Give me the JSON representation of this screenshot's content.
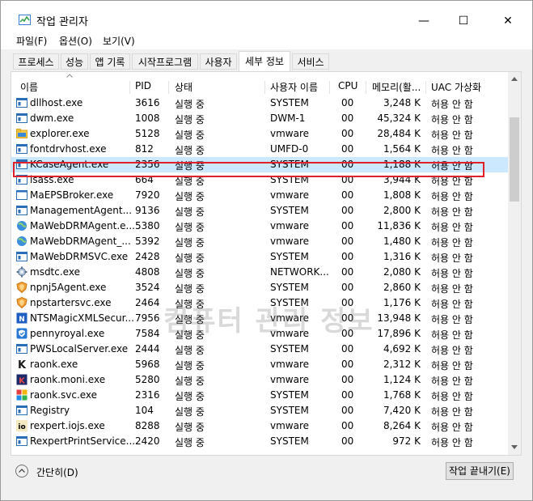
{
  "window": {
    "title": "작업 관리자",
    "controls": {
      "minimize": "—",
      "maximize": "☐",
      "close": "✕"
    }
  },
  "menu": [
    "파일(F)",
    "옵션(O)",
    "보기(V)"
  ],
  "tabs": [
    "프로세스",
    "성능",
    "앱 기록",
    "시작프로그램",
    "사용자",
    "세부 정보",
    "서비스"
  ],
  "active_tab": "세부 정보",
  "columns": {
    "name": "이름",
    "pid": "PID",
    "status": "상태",
    "user": "사용자 이름",
    "cpu": "CPU",
    "mem": "메모리(활...",
    "uac": "UAC 가상화"
  },
  "watermark": "컴퓨터 관리 정보",
  "rows": [
    {
      "name": "dllhost.exe",
      "pid": "3616",
      "status": "실행 중",
      "user": "SYSTEM",
      "cpu": "00",
      "mem": "3,248 K",
      "uac": "허용 안 함",
      "icon": "window-icon"
    },
    {
      "name": "dwm.exe",
      "pid": "1008",
      "status": "실행 중",
      "user": "DWM-1",
      "cpu": "00",
      "mem": "45,324 K",
      "uac": "허용 안 함",
      "icon": "window-icon"
    },
    {
      "name": "explorer.exe",
      "pid": "5128",
      "status": "실행 중",
      "user": "vmware",
      "cpu": "00",
      "mem": "28,484 K",
      "uac": "허용 안 함",
      "icon": "folder-icon"
    },
    {
      "name": "fontdrvhost.exe",
      "pid": "812",
      "status": "실행 중",
      "user": "UMFD-0",
      "cpu": "00",
      "mem": "1,564 K",
      "uac": "허용 안 함",
      "icon": "window-icon"
    },
    {
      "name": "KCaseAgent.exe",
      "pid": "2356",
      "status": "실행 중",
      "user": "SYSTEM",
      "cpu": "00",
      "mem": "1,188 K",
      "uac": "허용 안 함",
      "icon": "window-icon",
      "selected": true
    },
    {
      "name": "lsass.exe",
      "pid": "664",
      "status": "실행 중",
      "user": "SYSTEM",
      "cpu": "00",
      "mem": "3,944 K",
      "uac": "허용 안 함",
      "icon": "window-icon"
    },
    {
      "name": "MaEPSBroker.exe",
      "pid": "7920",
      "status": "실행 중",
      "user": "vmware",
      "cpu": "00",
      "mem": "1,808 K",
      "uac": "허용 안 함",
      "icon": "blank-window-icon"
    },
    {
      "name": "ManagementAgent...",
      "pid": "9136",
      "status": "실행 중",
      "user": "SYSTEM",
      "cpu": "00",
      "mem": "2,800 K",
      "uac": "허용 안 함",
      "icon": "window-icon"
    },
    {
      "name": "MaWebDRMAgent.e...",
      "pid": "5380",
      "status": "실행 중",
      "user": "vmware",
      "cpu": "00",
      "mem": "11,836 K",
      "uac": "허용 안 함",
      "icon": "globe-icon"
    },
    {
      "name": "MaWebDRMAgent_...",
      "pid": "5392",
      "status": "실행 중",
      "user": "vmware",
      "cpu": "00",
      "mem": "1,480 K",
      "uac": "허용 안 함",
      "icon": "globe-icon"
    },
    {
      "name": "MaWebDRMSVC.exe",
      "pid": "2428",
      "status": "실행 중",
      "user": "SYSTEM",
      "cpu": "00",
      "mem": "1,316 K",
      "uac": "허용 안 함",
      "icon": "window-icon"
    },
    {
      "name": "msdtc.exe",
      "pid": "4808",
      "status": "실행 중",
      "user": "NETWORK...",
      "cpu": "00",
      "mem": "2,080 K",
      "uac": "허용 안 함",
      "icon": "gear-icon"
    },
    {
      "name": "npnj5Agent.exe",
      "pid": "3524",
      "status": "실행 중",
      "user": "SYSTEM",
      "cpu": "00",
      "mem": "2,860 K",
      "uac": "허용 안 함",
      "icon": "shield-orange-icon"
    },
    {
      "name": "npstartersvc.exe",
      "pid": "2464",
      "status": "실행 중",
      "user": "SYSTEM",
      "cpu": "00",
      "mem": "1,176 K",
      "uac": "허용 안 함",
      "icon": "shield-orange-icon"
    },
    {
      "name": "NTSMagicXMLSecur...",
      "pid": "7956",
      "status": "실행 중",
      "user": "vmware",
      "cpu": "00",
      "mem": "13,948 K",
      "uac": "허용 안 함",
      "icon": "ns-blue-icon"
    },
    {
      "name": "pennyroyal.exe",
      "pid": "7584",
      "status": "실행 중",
      "user": "vmware",
      "cpu": "00",
      "mem": "17,896 K",
      "uac": "허용 안 함",
      "icon": "shield-blue-icon"
    },
    {
      "name": "PWSLocalServer.exe",
      "pid": "2444",
      "status": "실행 중",
      "user": "SYSTEM",
      "cpu": "00",
      "mem": "4,692 K",
      "uac": "허용 안 함",
      "icon": "window-icon"
    },
    {
      "name": "raonk.exe",
      "pid": "5968",
      "status": "실행 중",
      "user": "vmware",
      "cpu": "00",
      "mem": "2,312 K",
      "uac": "허용 안 함",
      "icon": "k-letter-icon"
    },
    {
      "name": "raonk.moni.exe",
      "pid": "5280",
      "status": "실행 중",
      "user": "vmware",
      "cpu": "00",
      "mem": "1,124 K",
      "uac": "허용 안 함",
      "icon": "k-navy-icon"
    },
    {
      "name": "raonk.svc.exe",
      "pid": "2316",
      "status": "실행 중",
      "user": "SYSTEM",
      "cpu": "00",
      "mem": "1,768 K",
      "uac": "허용 안 함",
      "icon": "colorful-squares-icon"
    },
    {
      "name": "Registry",
      "pid": "104",
      "status": "실행 중",
      "user": "SYSTEM",
      "cpu": "00",
      "mem": "7,420 K",
      "uac": "허용 안 함",
      "icon": "window-icon"
    },
    {
      "name": "rexpert.iojs.exe",
      "pid": "8288",
      "status": "실행 중",
      "user": "vmware",
      "cpu": "00",
      "mem": "8,264 K",
      "uac": "허용 안 함",
      "icon": "io-icon"
    },
    {
      "name": "RexpertPrintService....",
      "pid": "2420",
      "status": "실행 중",
      "user": "SYSTEM",
      "cpu": "00",
      "mem": "972 K",
      "uac": "허용 안 함",
      "icon": "window-icon"
    }
  ],
  "footer": {
    "collapse_label": "간단히(D)",
    "end_task_label": "작업 끝내기(E)"
  }
}
